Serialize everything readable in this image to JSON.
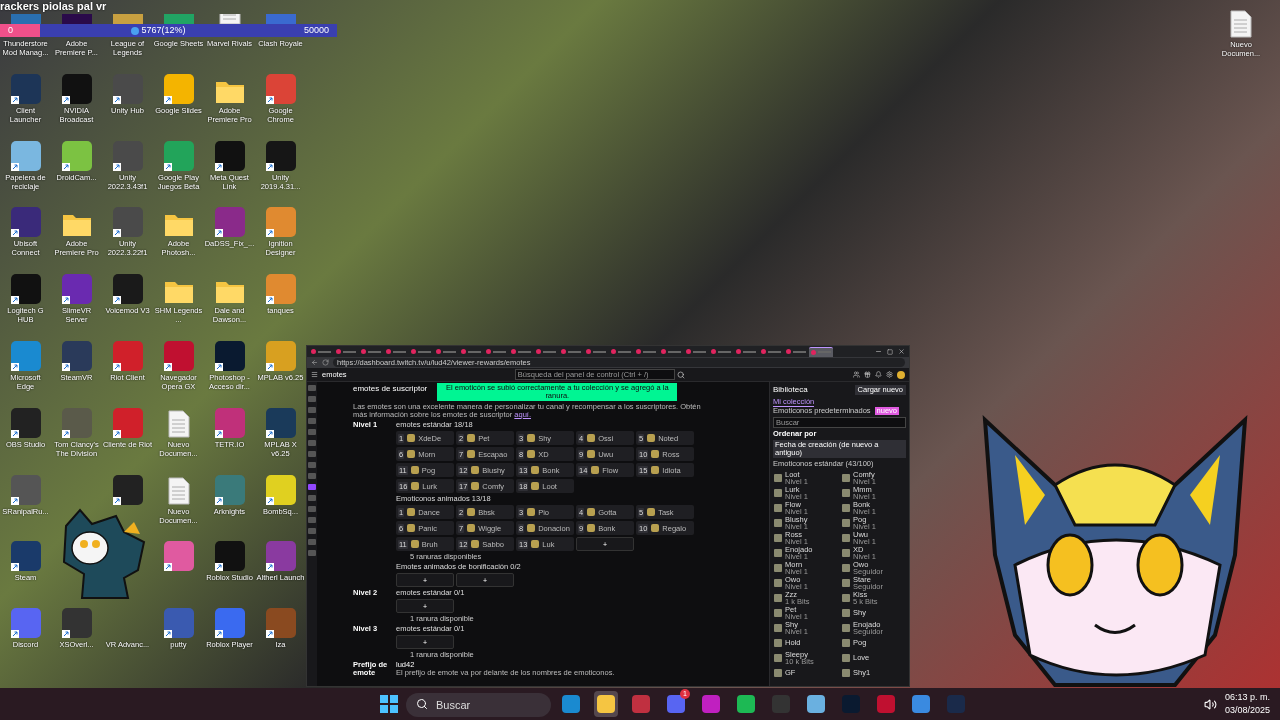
{
  "overlay": {
    "title": "rackers piolas pal vr",
    "goal": {
      "start": "0",
      "current": "5767(12%)",
      "end": "50000",
      "level": 0.12
    }
  },
  "desktop_icons": [
    {
      "label": "Thunderstore Mod Manag...",
      "kind": "app",
      "color": "#2a6fb0"
    },
    {
      "label": "Adobe Premiere P...",
      "kind": "app",
      "color": "#2a0a4a"
    },
    {
      "label": "League of Legends",
      "kind": "app",
      "color": "#c8a040"
    },
    {
      "label": "Google Sheets",
      "kind": "app",
      "color": "#21a464"
    },
    {
      "label": "Marvel Rivals",
      "kind": "document"
    },
    {
      "label": "Clash Royale",
      "kind": "app",
      "color": "#3a6ad0"
    },
    {
      "label": "Client Launcher",
      "kind": "app",
      "color": "#1d3557"
    },
    {
      "label": "NVIDIA Broadcast",
      "kind": "app",
      "color": "#111111"
    },
    {
      "label": "Unity Hub",
      "kind": "app",
      "color": "#4a4a4a"
    },
    {
      "label": "Google Slides",
      "kind": "app",
      "color": "#f4b400"
    },
    {
      "label": "Adobe Premiere Pro",
      "kind": "folder"
    },
    {
      "label": "Google Chrome",
      "kind": "app",
      "color": "#db4437"
    },
    {
      "label": "Papelera de reciclaje",
      "kind": "app",
      "color": "#7ab7e0"
    },
    {
      "label": "DroidCam...",
      "kind": "app",
      "color": "#7cc242"
    },
    {
      "label": "Unity 2022.3.43f1",
      "kind": "app",
      "color": "#4a4a4a"
    },
    {
      "label": "Google Play Juegos Beta",
      "kind": "app",
      "color": "#22a45a"
    },
    {
      "label": "Meta Quest Link",
      "kind": "app",
      "color": "#111111"
    },
    {
      "label": "Unity 2019.4.31...",
      "kind": "app",
      "color": "#161616"
    },
    {
      "label": "Ubisoft Connect",
      "kind": "app",
      "color": "#3a2a7a"
    },
    {
      "label": "Adobe Premiere Pro",
      "kind": "folder"
    },
    {
      "label": "Unity 2022.3.22f1",
      "kind": "app",
      "color": "#4a4a4a"
    },
    {
      "label": "Adobe Photosh...",
      "kind": "folder"
    },
    {
      "label": "DaDSS_Fix_...",
      "kind": "app",
      "color": "#8a2a8a"
    },
    {
      "label": "Ignition Designer",
      "kind": "app",
      "color": "#e08a30"
    },
    {
      "label": "Logitech G HUB",
      "kind": "app",
      "color": "#111111"
    },
    {
      "label": "SlimeVR Server",
      "kind": "app",
      "color": "#6a2ab0"
    },
    {
      "label": "Voicemod V3",
      "kind": "app",
      "color": "#1a1a1a"
    },
    {
      "label": "SHM Legends ...",
      "kind": "folder"
    },
    {
      "label": "Dale and Dawson...",
      "kind": "folder"
    },
    {
      "label": "tanques",
      "kind": "app",
      "color": "#e08a30"
    },
    {
      "label": "Microsoft Edge",
      "kind": "app",
      "color": "#1a8ad0"
    },
    {
      "label": "SteamVR",
      "kind": "app",
      "color": "#2a3a5a"
    },
    {
      "label": "Riot Client",
      "kind": "app",
      "color": "#d0202a"
    },
    {
      "label": "Navegador Opera GX",
      "kind": "app",
      "color": "#c01030"
    },
    {
      "label": "Photoshop - Acceso dir...",
      "kind": "app",
      "color": "#0a1a30"
    },
    {
      "label": "MPLAB v6.25",
      "kind": "app",
      "color": "#d8a020"
    },
    {
      "label": "OBS Studio",
      "kind": "app",
      "color": "#222222"
    },
    {
      "label": "Tom Clancy's The Division",
      "kind": "app",
      "color": "#5a5a4a"
    },
    {
      "label": "Cliente de Riot",
      "kind": "app",
      "color": "#d0202a"
    },
    {
      "label": "Nuevo Documen...",
      "kind": "document"
    },
    {
      "label": "TETR.IO",
      "kind": "app",
      "color": "#c0307a"
    },
    {
      "label": "MPLAB X v6.25",
      "kind": "app",
      "color": "#1a3a5a"
    },
    {
      "label": "SRanipalRu...",
      "kind": "app",
      "color": "#555555"
    },
    {
      "kind": "blank"
    },
    {
      "kind": "app",
      "color": "#222222"
    },
    {
      "label": "Nuevo Documen...",
      "kind": "document"
    },
    {
      "label": "Arknights",
      "kind": "app",
      "color": "#3a7a7a"
    },
    {
      "label": "BombSq...",
      "kind": "app",
      "color": "#e0d020"
    },
    {
      "label": "Steam",
      "kind": "app",
      "color": "#1a3a6a"
    },
    {
      "kind": "blank"
    },
    {
      "kind": "blank"
    },
    {
      "kind": "app",
      "color": "#e05aa0"
    },
    {
      "label": "Roblox Studio",
      "kind": "app",
      "color": "#111111"
    },
    {
      "label": "Altherl Launch",
      "kind": "app",
      "color": "#8a3aa0"
    },
    {
      "label": "Discord",
      "kind": "app",
      "color": "#5865f2"
    },
    {
      "label": "XSOverl...",
      "kind": "app",
      "color": "#333333"
    },
    {
      "label": "VR Advanc...",
      "kind": "blank"
    },
    {
      "label": "putty",
      "kind": "app",
      "color": "#3a5ab0"
    },
    {
      "label": "Roblox Player",
      "kind": "app",
      "color": "#3a6af0"
    },
    {
      "label": "Iza",
      "kind": "app",
      "color": "#8a4a20"
    }
  ],
  "desktop_icons_right": [
    {
      "label": "Nuevo Documen...",
      "kind": "document"
    }
  ],
  "browser": {
    "tabs": [
      {
        "selected": false
      },
      {
        "selected": false
      },
      {
        "selected": false
      },
      {
        "selected": false
      },
      {
        "selected": false
      },
      {
        "selected": false
      },
      {
        "selected": false
      },
      {
        "selected": false
      },
      {
        "selected": false
      },
      {
        "selected": false
      },
      {
        "selected": false
      },
      {
        "selected": false
      },
      {
        "selected": false
      },
      {
        "selected": false
      },
      {
        "selected": false
      },
      {
        "selected": false
      },
      {
        "selected": false
      },
      {
        "selected": false
      },
      {
        "selected": false
      },
      {
        "selected": false
      },
      {
        "selected": true
      }
    ],
    "url": "https://dashboard.twitch.tv/u/lud42/viewer-rewards/emotes",
    "page_title": "emotes",
    "search": {
      "placeholder": "Búsqueda del panel de control (Ctrl + /)"
    },
    "rail_items": [
      {
        "selected": false
      },
      {
        "selected": false
      },
      {
        "selected": false
      },
      {
        "selected": false
      },
      {
        "selected": false
      },
      {
        "selected": false
      },
      {
        "selected": false
      },
      {
        "selected": false
      },
      {
        "selected": false
      },
      {
        "selected": true
      },
      {
        "selected": false
      },
      {
        "selected": false
      },
      {
        "selected": false
      },
      {
        "selected": false
      },
      {
        "selected": false
      },
      {
        "selected": false
      }
    ],
    "section_title": "emotes de suscriptor",
    "toast": "El emoticón se subió correctamente a tu colección y se agregó a la ranura.",
    "description": "Las emotes son una excelente manera de personalizar tu canal y recompensar a los suscriptores. Obtén más información sobre los emotes de suscriptor",
    "description_link": "aquí.",
    "tiers": [
      {
        "name": "Nivel 1",
        "groups": [
          {
            "title": "emotes estándar 18/18",
            "slots": [
              {
                "kind": "emote",
                "number": "1",
                "name": "XdeDe"
              },
              {
                "kind": "emote",
                "number": "2",
                "name": "Pet"
              },
              {
                "kind": "emote",
                "number": "3",
                "name": "Shy"
              },
              {
                "kind": "emote",
                "number": "4",
                "name": "Ossi"
              },
              {
                "kind": "emote",
                "number": "5",
                "name": "Noted"
              },
              {
                "kind": "emote",
                "number": "6",
                "name": "Morn"
              },
              {
                "kind": "emote",
                "number": "7",
                "name": "Escapao"
              },
              {
                "kind": "emote",
                "number": "8",
                "name": "XD"
              },
              {
                "kind": "emote",
                "number": "9",
                "name": "Uwu"
              },
              {
                "kind": "emote",
                "number": "10",
                "name": "Ross"
              },
              {
                "kind": "emote",
                "number": "11",
                "name": "Pog"
              },
              {
                "kind": "emote",
                "number": "12",
                "name": "Blushy"
              },
              {
                "kind": "emote",
                "number": "13",
                "name": "Bonk"
              },
              {
                "kind": "emote",
                "number": "14",
                "name": "Flow"
              },
              {
                "kind": "emote",
                "number": "15",
                "name": "Idiota"
              },
              {
                "kind": "emote",
                "number": "16",
                "name": "Lurk"
              },
              {
                "kind": "emote",
                "number": "17",
                "name": "Comfy"
              },
              {
                "kind": "emote",
                "number": "18",
                "name": "Loot"
              }
            ]
          },
          {
            "title": "Emoticonos animados 13/18",
            "slots": [
              {
                "kind": "emote",
                "number": "1",
                "name": "Dance"
              },
              {
                "kind": "emote",
                "number": "2",
                "name": "Bbsk"
              },
              {
                "kind": "emote",
                "number": "3",
                "name": "Pio"
              },
              {
                "kind": "emote",
                "number": "4",
                "name": "Gotta"
              },
              {
                "kind": "emote",
                "number": "5",
                "name": "Task"
              },
              {
                "kind": "emote",
                "number": "6",
                "name": "Panic"
              },
              {
                "kind": "emote",
                "number": "7",
                "name": "Wiggle"
              },
              {
                "kind": "emote",
                "number": "8",
                "name": "Donacion"
              },
              {
                "kind": "emote",
                "number": "9",
                "name": "Bonk"
              },
              {
                "kind": "emote",
                "number": "10",
                "name": "Regalo"
              },
              {
                "kind": "emote",
                "number": "11",
                "name": "Bruh"
              },
              {
                "kind": "emote",
                "number": "12",
                "name": "Sabbo"
              },
              {
                "kind": "emote",
                "number": "13",
                "name": "Luk"
              },
              {
                "kind": "empty",
                "icon": "+"
              }
            ],
            "note": "5 ranuras disponibles"
          },
          {
            "title": "Emotes animados de bonificación 0/2",
            "slots": [
              {
                "kind": "empty",
                "icon": "+"
              },
              {
                "kind": "empty",
                "icon": "+"
              }
            ]
          }
        ]
      },
      {
        "name": "Nivel 2",
        "groups": [
          {
            "title": "emotes estándar 0/1",
            "slots": [
              {
                "kind": "empty",
                "icon": "+"
              }
            ],
            "note": "1 ranura disponible"
          }
        ]
      },
      {
        "name": "Nivel 3",
        "groups": [
          {
            "title": "emotes estándar 0/1",
            "slots": [
              {
                "kind": "empty",
                "icon": "+"
              }
            ],
            "note": "1 ranura disponible"
          }
        ]
      }
    ],
    "prefix": {
      "label": "Prefijo de emote",
      "value": "lud42",
      "hint": "El prefijo de emote va por delante de los nombres de emoticonos."
    },
    "library": {
      "title": "Biblioteca",
      "upload": "Cargar nuevo",
      "tabs": [
        {
          "label": "Mi colección",
          "selected": true
        },
        {
          "label": "Emoticonos predeterminados",
          "selected": false
        }
      ],
      "badge": "nuevo",
      "search": {
        "placeholder": "Buscar"
      },
      "sort_label": "Ordenar por",
      "sort_value": "Fecha de creación (de nuevo a antiguo)",
      "list_title": "Emoticonos estándar (43/100)",
      "items": [
        {
          "name": "Loot",
          "tier": "Nivel 1"
        },
        {
          "name": "Comfy",
          "tier": "Nivel 1"
        },
        {
          "name": "Lurk",
          "tier": "Nivel 1"
        },
        {
          "name": "Mmm",
          "tier": "Nivel 1"
        },
        {
          "name": "Flow",
          "tier": "Nivel 1"
        },
        {
          "name": "Bonk",
          "tier": "Nivel 1"
        },
        {
          "name": "Blushy",
          "tier": "Nivel 1"
        },
        {
          "name": "Pog",
          "tier": "Nivel 1"
        },
        {
          "name": "Ross",
          "tier": "Nivel 1"
        },
        {
          "name": "Uwu",
          "tier": "Nivel 1"
        },
        {
          "name": "Enojado",
          "tier": "Nivel 1"
        },
        {
          "name": "XD",
          "tier": "Nivel 1"
        },
        {
          "name": "Morn",
          "tier": "Nivel 1"
        },
        {
          "name": "Owo",
          "tier": "Seguidor"
        },
        {
          "name": "Owo",
          "tier": "Nivel 1"
        },
        {
          "name": "Stare",
          "tier": "Seguidor"
        },
        {
          "name": "Zzz",
          "tier": "1 k Bits"
        },
        {
          "name": "Kiss",
          "tier": "5 k Bits"
        },
        {
          "name": "Pet",
          "tier": "Nivel 1"
        },
        {
          "name": "Shy"
        },
        {
          "name": "Shy",
          "tier": "Nivel 1"
        },
        {
          "name": "Enojado",
          "tier": "Seguidor"
        },
        {
          "name": "Hold"
        },
        {
          "name": "Pog"
        },
        {
          "name": "Sleepy",
          "tier": "10 k Bits"
        },
        {
          "name": "Love"
        },
        {
          "name": "GF"
        },
        {
          "name": "Shy1"
        }
      ]
    }
  },
  "taskbar": {
    "search": {
      "placeholder": "Buscar"
    },
    "apps": [
      {
        "kind": "edge",
        "selected": false
      },
      {
        "kind": "folder",
        "selected": true
      },
      {
        "kind": "m",
        "selected": false
      },
      {
        "kind": "discord",
        "selected": false,
        "badge": "1"
      },
      {
        "kind": "c",
        "selected": false
      },
      {
        "kind": "spotify",
        "selected": false
      },
      {
        "kind": "obs",
        "selected": false
      },
      {
        "kind": "notepad",
        "selected": false
      },
      {
        "kind": "ps",
        "selected": false
      },
      {
        "kind": "opera",
        "selected": false
      },
      {
        "kind": "photos",
        "selected": false
      },
      {
        "kind": "steam",
        "selected": false
      }
    ],
    "time": "06:13 p. m.",
    "date": "03/08/2025"
  }
}
